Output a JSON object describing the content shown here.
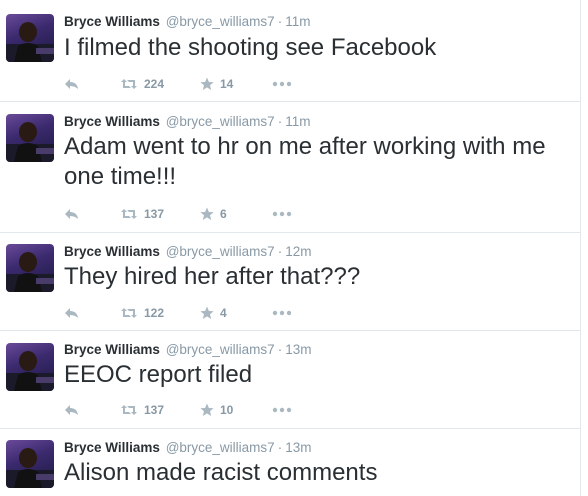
{
  "colors": {
    "muted": "#8899a6",
    "text": "#292f33",
    "divider": "#e1e8ed"
  },
  "icons": [
    "reply-icon",
    "retweet-icon",
    "favorite-star-icon",
    "more-dots-icon"
  ],
  "tweets": [
    {
      "name": "Bryce Williams",
      "handle": "@bryce_williams7",
      "separator": "·",
      "time": "11m",
      "text": "I filmed the shooting see Facebook",
      "retweets": "224",
      "favorites": "14"
    },
    {
      "name": "Bryce Williams",
      "handle": "@bryce_williams7",
      "separator": "·",
      "time": "11m",
      "text": "Adam went to hr on me after working with me one time!!!",
      "retweets": "137",
      "favorites": "6"
    },
    {
      "name": "Bryce Williams",
      "handle": "@bryce_williams7",
      "separator": "·",
      "time": "12m",
      "text": "They hired her after that???",
      "retweets": "122",
      "favorites": "4"
    },
    {
      "name": "Bryce Williams",
      "handle": "@bryce_williams7",
      "separator": "·",
      "time": "13m",
      "text": "EEOC report filed",
      "retweets": "137",
      "favorites": "10"
    },
    {
      "name": "Bryce Williams",
      "handle": "@bryce_williams7",
      "separator": "·",
      "time": "13m",
      "text": "Alison made racist comments"
    }
  ]
}
